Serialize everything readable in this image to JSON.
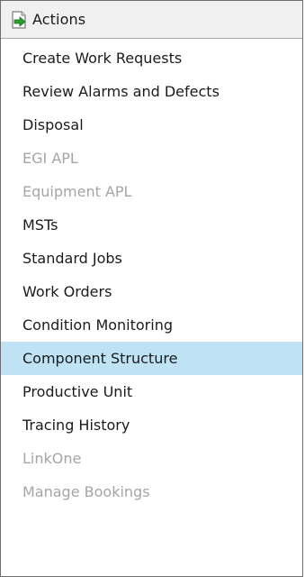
{
  "panel": {
    "title": "Actions",
    "icon": "document-arrow-icon",
    "colors": {
      "selected_background": "#bfe3f5",
      "disabled_text": "#a5a5a5",
      "icon_arrow": "#2e9b2e"
    }
  },
  "items": [
    {
      "label": "Create Work Requests",
      "state": "enabled"
    },
    {
      "label": "Review Alarms and Defects",
      "state": "enabled"
    },
    {
      "label": "Disposal",
      "state": "enabled"
    },
    {
      "label": "EGI APL",
      "state": "disabled"
    },
    {
      "label": "Equipment APL",
      "state": "disabled"
    },
    {
      "label": "MSTs",
      "state": "enabled"
    },
    {
      "label": "Standard Jobs",
      "state": "enabled"
    },
    {
      "label": "Work Orders",
      "state": "enabled"
    },
    {
      "label": "Condition Monitoring",
      "state": "enabled"
    },
    {
      "label": "Component Structure",
      "state": "selected"
    },
    {
      "label": "Productive Unit",
      "state": "enabled"
    },
    {
      "label": "Tracing History",
      "state": "enabled"
    },
    {
      "label": "LinkOne",
      "state": "disabled"
    },
    {
      "label": "Manage Bookings",
      "state": "disabled"
    }
  ]
}
